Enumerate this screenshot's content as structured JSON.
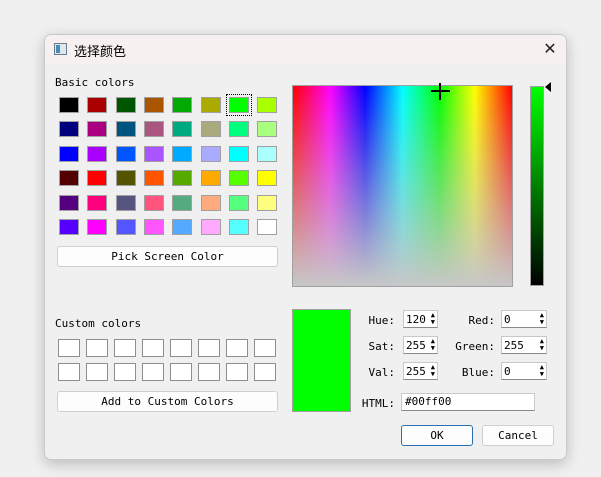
{
  "window": {
    "title": "选择颜色",
    "close_glyph": "✕"
  },
  "basic": {
    "label": "Basic colors",
    "colors": [
      "#000000",
      "#aa0000",
      "#005500",
      "#aa5500",
      "#00aa00",
      "#aaaa00",
      "#00ff00",
      "#aaff00",
      "#00007f",
      "#aa007f",
      "#00557f",
      "#aa557f",
      "#00aa7f",
      "#aaaa7f",
      "#00ff7f",
      "#aaff7f",
      "#0000ff",
      "#aa00ff",
      "#0055ff",
      "#aa55ff",
      "#00aaff",
      "#aaaaff",
      "#00ffff",
      "#aaffff",
      "#550000",
      "#ff0000",
      "#555500",
      "#ff5500",
      "#55aa00",
      "#ffaa00",
      "#55ff00",
      "#ffff00",
      "#55007f",
      "#ff007f",
      "#55557f",
      "#ff557f",
      "#55aa7f",
      "#ffaa7f",
      "#55ff7f",
      "#ffff7f",
      "#5500ff",
      "#ff00ff",
      "#5555ff",
      "#ff55ff",
      "#55aaff",
      "#ffaaff",
      "#55ffff",
      "#ffffff"
    ],
    "selected_index": 6
  },
  "pick_screen_label": "Pick Screen Color",
  "custom": {
    "label": "Custom colors",
    "count": 16
  },
  "add_custom_label": "Add to Custom Colors",
  "current_color": "#00ff00",
  "fields": {
    "hue": {
      "label": "Hue:",
      "value": "120"
    },
    "sat": {
      "label": "Sat:",
      "value": "255"
    },
    "val": {
      "label": "Val:",
      "value": "255"
    },
    "red": {
      "label": "Red:",
      "value": "0"
    },
    "green": {
      "label": "Green:",
      "value": "255"
    },
    "blue": {
      "label": "Blue:",
      "value": "0"
    },
    "html": {
      "label": "HTML:",
      "value": "#00ff00"
    }
  },
  "spin_up_glyph": "▲",
  "spin_down_glyph": "▼",
  "buttons": {
    "ok": "OK",
    "cancel": "Cancel"
  }
}
